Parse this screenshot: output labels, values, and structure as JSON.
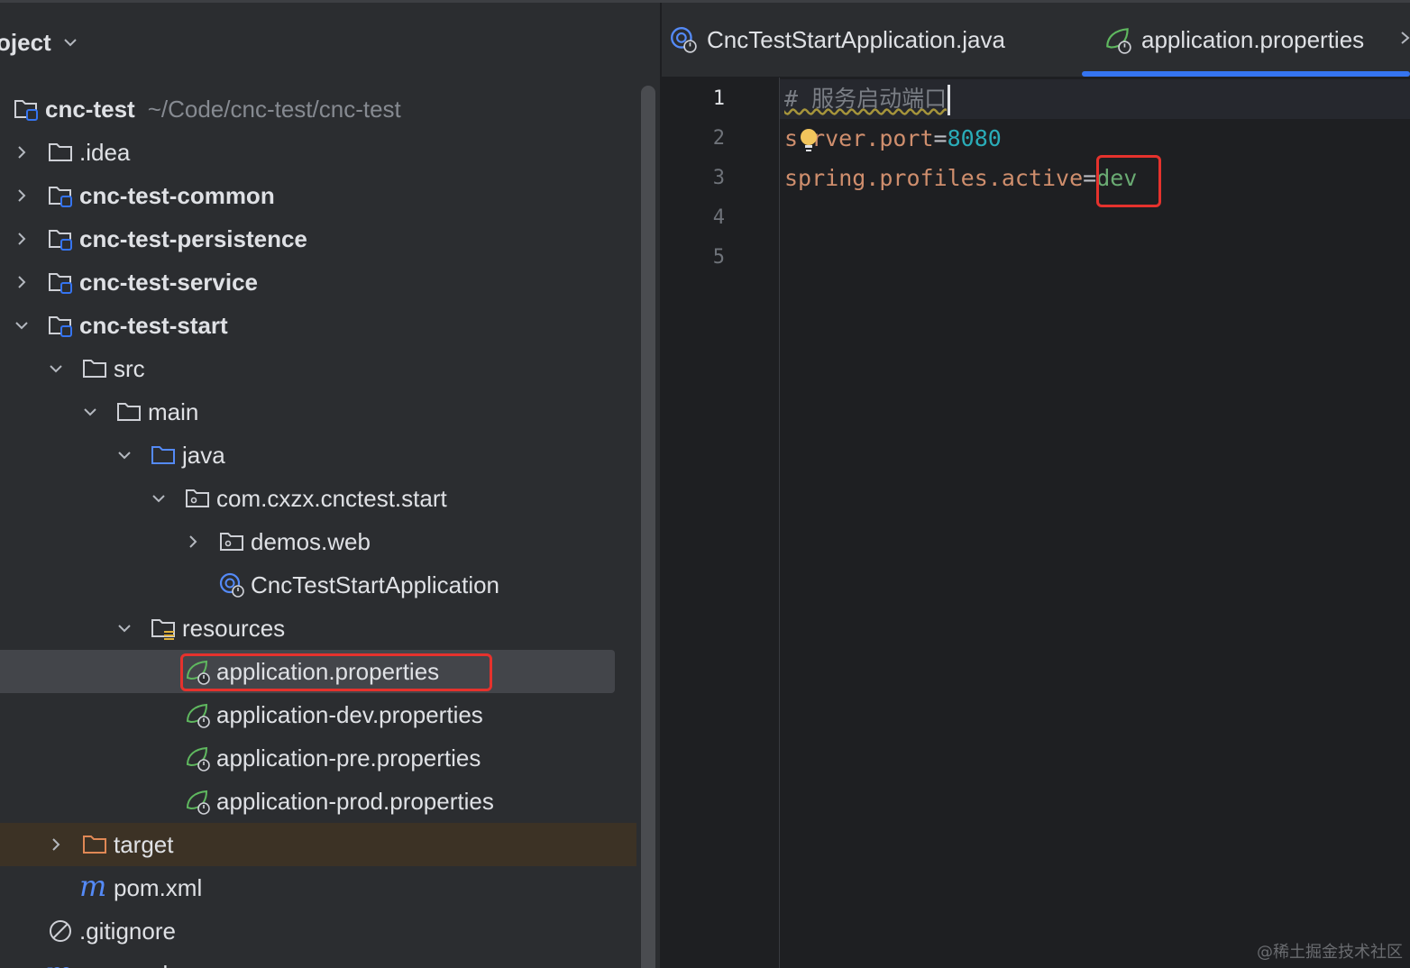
{
  "project_panel": {
    "title": "oject",
    "root": {
      "name": "cnc-test",
      "path": "~/Code/cnc-test/cnc-test"
    },
    "items": [
      {
        "label": "cnc-test",
        "path": "~/Code/cnc-test/cnc-test",
        "icon": "module-folder-icon",
        "state": "root"
      },
      {
        "label": ".idea",
        "icon": "folder-icon",
        "state": "collapsed"
      },
      {
        "label": "cnc-test-common",
        "icon": "module-folder-icon",
        "state": "collapsed"
      },
      {
        "label": "cnc-test-persistence",
        "icon": "module-folder-icon",
        "state": "collapsed"
      },
      {
        "label": "cnc-test-service",
        "icon": "module-folder-icon",
        "state": "collapsed"
      },
      {
        "label": "cnc-test-start",
        "icon": "module-folder-icon",
        "state": "expanded"
      },
      {
        "label": "src",
        "icon": "folder-icon",
        "state": "expanded"
      },
      {
        "label": "main",
        "icon": "folder-icon",
        "state": "expanded"
      },
      {
        "label": "java",
        "icon": "source-folder-icon",
        "state": "expanded"
      },
      {
        "label": "com.cxzx.cnctest.start",
        "icon": "package-icon",
        "state": "expanded"
      },
      {
        "label": "demos.web",
        "icon": "package-icon",
        "state": "collapsed"
      },
      {
        "label": "CncTestStartApplication",
        "icon": "spring-boot-class-icon",
        "state": "leaf"
      },
      {
        "label": "resources",
        "icon": "resources-folder-icon",
        "state": "expanded"
      },
      {
        "label": "application.properties",
        "icon": "spring-properties-icon",
        "state": "selected"
      },
      {
        "label": "application-dev.properties",
        "icon": "spring-properties-icon",
        "state": "leaf"
      },
      {
        "label": "application-pre.properties",
        "icon": "spring-properties-icon",
        "state": "leaf"
      },
      {
        "label": "application-prod.properties",
        "icon": "spring-properties-icon",
        "state": "leaf"
      },
      {
        "label": "target",
        "icon": "excluded-folder-icon",
        "state": "collapsed"
      },
      {
        "label": "pom.xml",
        "icon": "maven-icon",
        "state": "leaf"
      },
      {
        "label": ".gitignore",
        "icon": "ignore-icon",
        "state": "leaf"
      },
      {
        "label": "pom.xml",
        "icon": "maven-icon",
        "state": "leaf"
      }
    ]
  },
  "editor": {
    "tabs": [
      {
        "label": "CncTestStartApplication.java",
        "icon": "spring-boot-class-icon",
        "active": false
      },
      {
        "label": "application.properties",
        "icon": "spring-properties-icon",
        "active": true
      }
    ],
    "lines": [
      {
        "number": "1",
        "comment": "# 服务启动端口"
      },
      {
        "number": "2",
        "key_a": "s",
        "key_b": "rver.port",
        "eq": "=",
        "value": "8080"
      },
      {
        "number": "3",
        "key": "spring.profiles.active",
        "eq": "=",
        "value": "dev"
      },
      {
        "number": "4"
      },
      {
        "number": "5"
      }
    ]
  },
  "watermark": "@稀土掘金技术社区",
  "colors": {
    "accent": "#3574f0",
    "highlight_box": "#e5322d",
    "property_key": "#cf8e6d",
    "number": "#2aacb8",
    "string_value": "#6aab73",
    "spring_icon": "#5fb85f"
  }
}
